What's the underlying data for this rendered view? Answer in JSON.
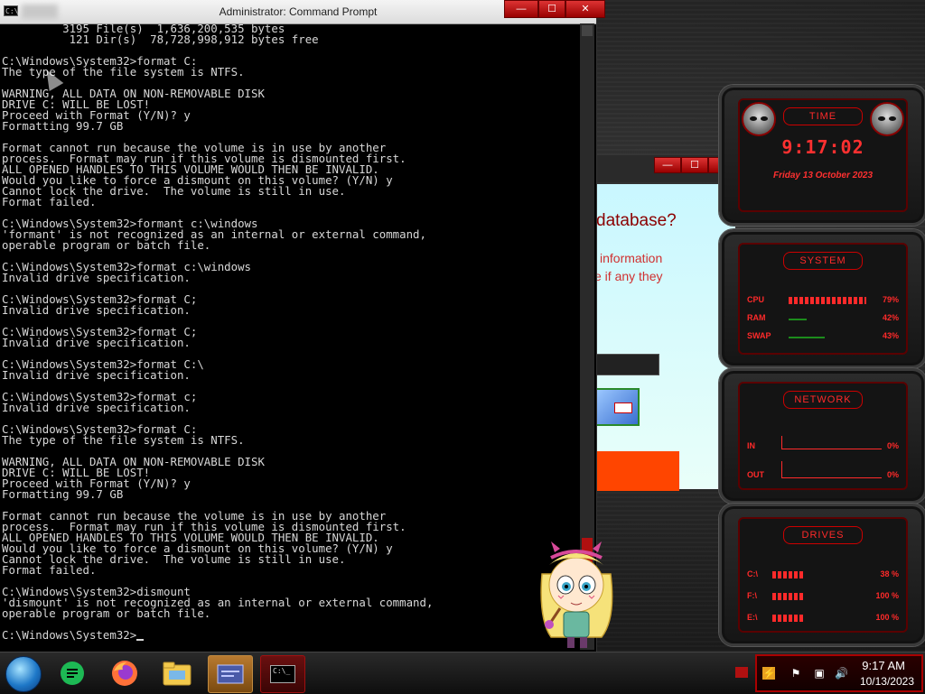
{
  "cmd": {
    "title": "Administrator: Command Prompt",
    "minimize_label": "—",
    "maximize_label": "☐",
    "close_label": "✕",
    "lines": [
      "         3195 File(s)  1,636,200,535 bytes",
      "          121 Dir(s)  78,728,998,912 bytes free",
      "",
      "C:\\Windows\\System32>format C:",
      "The type of the file system is NTFS.",
      "",
      "WARNING, ALL DATA ON NON-REMOVABLE DISK",
      "DRIVE C: WILL BE LOST!",
      "Proceed with Format (Y/N)? y",
      "Formatting 99.7 GB",
      "",
      "Format cannot run because the volume is in use by another",
      "process.  Format may run if this volume is dismounted first.",
      "ALL OPENED HANDLES TO THIS VOLUME WOULD THEN BE INVALID.",
      "Would you like to force a dismount on this volume? (Y/N) y",
      "Cannot lock the drive.  The volume is still in use.",
      "Format failed.",
      "",
      "C:\\Windows\\System32>formant c:\\windows",
      "'formant' is not recognized as an internal or external command,",
      "operable program or batch file.",
      "",
      "C:\\Windows\\System32>format c:\\windows",
      "Invalid drive specification.",
      "",
      "C:\\Windows\\System32>format C;",
      "Invalid drive specification.",
      "",
      "C:\\Windows\\System32>format C;",
      "Invalid drive specification.",
      "",
      "C:\\Windows\\System32>format C:\\",
      "Invalid drive specification.",
      "",
      "C:\\Windows\\System32>format c;",
      "Invalid drive specification.",
      "",
      "C:\\Windows\\System32>format C:",
      "The type of the file system is NTFS.",
      "",
      "WARNING, ALL DATA ON NON-REMOVABLE DISK",
      "DRIVE C: WILL BE LOST!",
      "Proceed with Format (Y/N)? y",
      "Formatting 99.7 GB",
      "",
      "Format cannot run because the volume is in use by another",
      "process.  Format may run if this volume is dismounted first.",
      "ALL OPENED HANDLES TO THIS VOLUME WOULD THEN BE INVALID.",
      "Would you like to force a dismount on this volume? (Y/N) y",
      "Cannot lock the drive.  The volume is still in use.",
      "Format failed.",
      "",
      "C:\\Windows\\System32>dismount",
      "'dismount' is not recognized as an internal or external command,",
      "operable program or batch file.",
      ""
    ],
    "prompt": "C:\\Windows\\System32>"
  },
  "dialog": {
    "heading": "database?",
    "line1": "information",
    "line2": "e if any they",
    "action_color": "#ff4500"
  },
  "widgets": {
    "time": {
      "header": "TIME",
      "time": "9:17:02",
      "date": "Friday 13 October 2023"
    },
    "system": {
      "header": "SYSTEM",
      "rows": [
        {
          "label": "CPU",
          "value": "79%"
        },
        {
          "label": "RAM",
          "value": "42%"
        },
        {
          "label": "SWAP",
          "value": "43%"
        }
      ]
    },
    "network": {
      "header": "NETWORK",
      "rows": [
        {
          "label": "IN",
          "value": "0%"
        },
        {
          "label": "OUT",
          "value": "0%"
        }
      ]
    },
    "drives": {
      "header": "DRIVES",
      "rows": [
        {
          "label": "C:\\",
          "value": "38 %"
        },
        {
          "label": "F:\\",
          "value": "100 %"
        },
        {
          "label": "E:\\",
          "value": "100 %"
        }
      ]
    }
  },
  "taskbar": {
    "apps": [
      {
        "name": "start-orb-icon"
      },
      {
        "name": "chat-app-icon",
        "color": "#1db954"
      },
      {
        "name": "firefox-icon",
        "color": "#ff7139"
      },
      {
        "name": "file-explorer-icon",
        "color": "#f2c94c"
      },
      {
        "name": "window-app-icon"
      },
      {
        "name": "command-prompt-icon",
        "glyph": "C:\\_"
      }
    ],
    "clock_time": "9:17 AM",
    "clock_date": "10/13/2023"
  },
  "colors": {
    "accent_red": "#ff2a2a",
    "terminal_text": "#d8d8d8",
    "terminal_bg": "#000000"
  }
}
